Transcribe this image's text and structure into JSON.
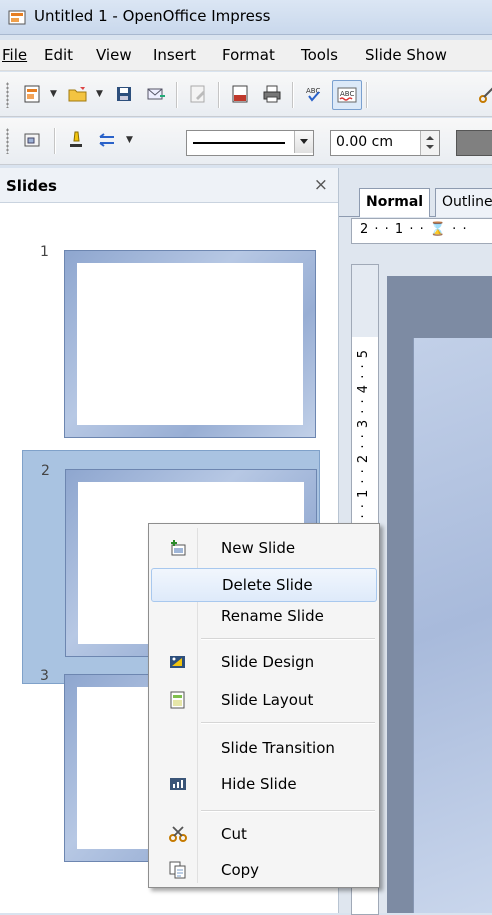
{
  "window": {
    "title": "Untitled 1 - OpenOffice Impress"
  },
  "menubar": {
    "items": [
      "File",
      "Edit",
      "View",
      "Insert",
      "Format",
      "Tools",
      "Slide Show"
    ]
  },
  "toolbar2": {
    "line_width": "0.00 cm"
  },
  "slides_pane": {
    "title": "Slides",
    "close_glyph": "×",
    "slides": [
      {
        "number": "1"
      },
      {
        "number": "2"
      },
      {
        "number": "3"
      }
    ]
  },
  "workspace": {
    "tabs": [
      "Normal",
      "Outline"
    ],
    "hruler_text": "2 · · 1 · · ⌛ · ·",
    "vruler_text": "· · 1 · · · 1 · · 2 · · 3 · · 4 · · 5"
  },
  "context_menu": {
    "items": [
      {
        "label": "New Slide",
        "icon": "new-slide-icon"
      },
      {
        "label": "Delete Slide",
        "highlighted": true
      },
      {
        "label": "Rename Slide"
      },
      {
        "label": "Slide Design",
        "icon": "slide-design-icon"
      },
      {
        "label": "Slide Layout",
        "icon": "slide-layout-icon"
      },
      {
        "label": "Slide Transition"
      },
      {
        "label": "Hide Slide",
        "icon": "hide-slide-icon"
      },
      {
        "label": "Cut",
        "icon": "scissors-icon"
      },
      {
        "label": "Copy",
        "icon": "copy-icon"
      }
    ]
  },
  "colors": {
    "accent": "#a9c3e1",
    "hover": "#deeafa",
    "slide_border": "#8ea6cf"
  }
}
